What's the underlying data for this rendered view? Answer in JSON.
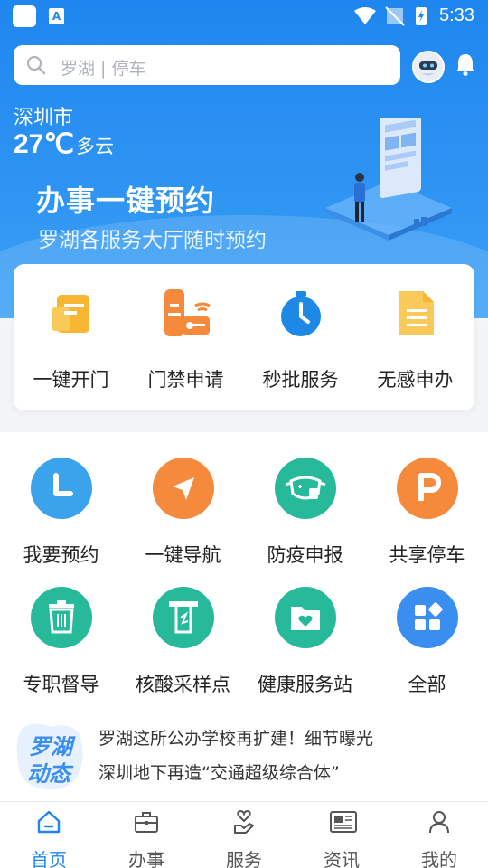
{
  "status_bar": {
    "time": "5:33",
    "badge": "A"
  },
  "search": {
    "placeholder": "罗湖 | 停车"
  },
  "weather": {
    "city": "深圳市",
    "temperature": "27℃",
    "condition": "多云"
  },
  "banner": {
    "title": "办事一键预约",
    "subtitle": "罗湖各服务大厅随时预约"
  },
  "quick_actions": [
    {
      "label": "一键开门",
      "icon": "card-reader-icon"
    },
    {
      "label": "门禁申请",
      "icon": "access-control-icon"
    },
    {
      "label": "秒批服务",
      "icon": "stopwatch-icon"
    },
    {
      "label": "无感申办",
      "icon": "document-icon"
    }
  ],
  "services": [
    {
      "label": "我要预约",
      "icon": "clock-icon",
      "color": "#3aa3ec"
    },
    {
      "label": "一键导航",
      "icon": "navigation-icon",
      "color": "#f58a3c"
    },
    {
      "label": "防疫申报",
      "icon": "mask-icon",
      "color": "#26b99a"
    },
    {
      "label": "共享停车",
      "icon": "parking-icon",
      "color": "#f58a3c"
    },
    {
      "label": "专职督导",
      "icon": "trash-icon",
      "color": "#26b99a"
    },
    {
      "label": "核酸采样点",
      "icon": "test-tube-icon",
      "color": "#26b99a"
    },
    {
      "label": "健康服务站",
      "icon": "health-folder-icon",
      "color": "#26b99a"
    },
    {
      "label": "全部",
      "icon": "grid-icon",
      "color": "#3a8ef0"
    }
  ],
  "news": {
    "logo_text": [
      "罗湖",
      "动态"
    ],
    "items": [
      "罗湖这所公办学校再扩建！细节曝光",
      "深圳地下再造“交通超级综合体”"
    ]
  },
  "tabs": [
    {
      "label": "首页",
      "icon": "home-icon",
      "active": true
    },
    {
      "label": "办事",
      "icon": "briefcase-icon",
      "active": false
    },
    {
      "label": "服务",
      "icon": "heart-hand-icon",
      "active": false
    },
    {
      "label": "资讯",
      "icon": "newspaper-icon",
      "active": false
    },
    {
      "label": "我的",
      "icon": "user-icon",
      "active": false
    }
  ],
  "colors": {
    "primary": "#1f86ef",
    "orange": "#f58a3c",
    "green": "#26b99a",
    "yellow": "#f7b733"
  }
}
